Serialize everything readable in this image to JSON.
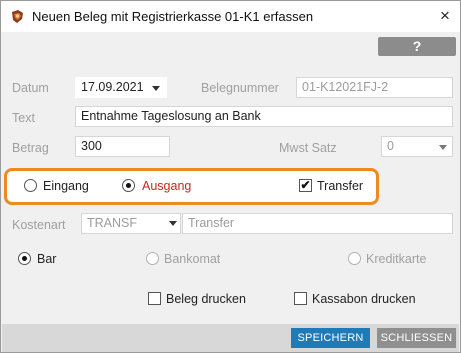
{
  "window": {
    "title": "Neuen Beleg mit Registrierkasse 01-K1 erfassen",
    "close_glyph": "×",
    "help_label": "?"
  },
  "form": {
    "datum_label": "Datum",
    "datum_value": "17.09.2021",
    "belegnummer_label": "Belegnummer",
    "belegnummer_value": "01-K12021FJ-2",
    "text_label": "Text",
    "text_value": "Entnahme Tageslosung an Bank",
    "betrag_label": "Betrag",
    "betrag_value": "300",
    "mwst_label": "Mwst Satz",
    "mwst_value": "0"
  },
  "direction": {
    "eingang_label": "Eingang",
    "ausgang_label": "Ausgang",
    "transfer_label": "Transfer",
    "selected": "Ausgang",
    "transfer_checked": true,
    "check_glyph": "✔"
  },
  "kostenart": {
    "label": "Kostenart",
    "code": "TRANSF",
    "description": "Transfer"
  },
  "payment": {
    "bar_label": "Bar",
    "bankomat_label": "Bankomat",
    "kreditkarte_label": "Kreditkarte",
    "selected": "Bar"
  },
  "print": {
    "beleg_label": "Beleg drucken",
    "kassabon_label": "Kassabon drucken"
  },
  "buttons": {
    "save_label": "SPEICHERN",
    "close_label": "SCHLIESSEN"
  },
  "colors": {
    "accent_orange": "#ef8a22",
    "primary_button": "#1f7ab8",
    "ausgang_red": "#c8281e"
  }
}
